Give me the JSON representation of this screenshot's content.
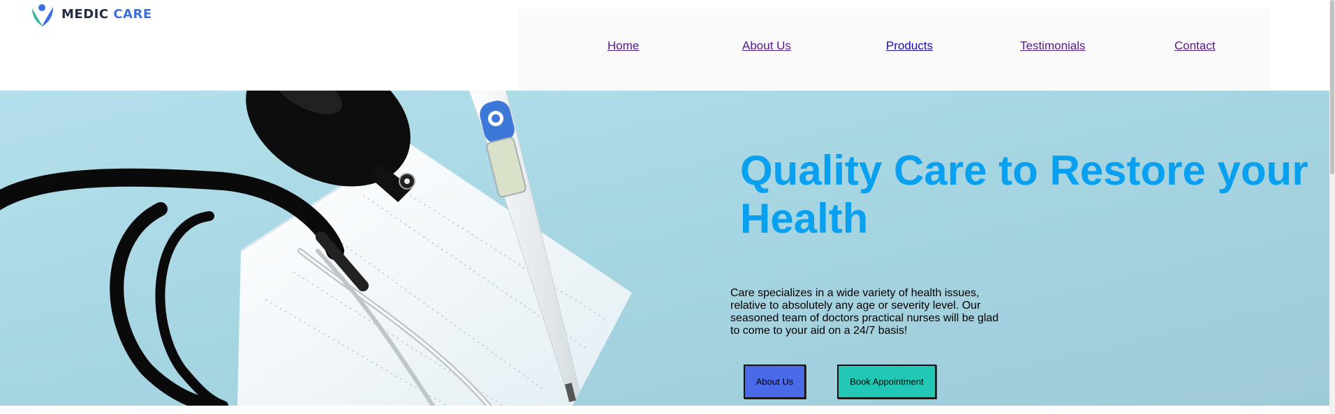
{
  "brand": {
    "name_part1": "MEDIC",
    "name_part2": "CARE"
  },
  "nav": {
    "items": [
      {
        "label": "Home"
      },
      {
        "label": "About Us"
      },
      {
        "label": "Products"
      },
      {
        "label": "Testimonials"
      },
      {
        "label": "Contact"
      }
    ]
  },
  "hero": {
    "title": "Quality Care to Restore your Health",
    "description": "Care specializes in a wide variety of health issues, relative to absolutely any age or severity level. Our seasoned team of doctors practical nurses will be glad to come to your aid on a 24/7 basis!",
    "about_button": "About Us",
    "book_button": "Book Appointment"
  },
  "colors": {
    "hero_title": "#0aa0f0",
    "hero_background": "#a9d6e3",
    "about_button": "#4a6ae8",
    "book_button": "#22c7b5",
    "nav_background": "#fafafa",
    "brand_accent": "#3b6fe0"
  },
  "icons": [
    "logo-mark-icon"
  ],
  "hero_image": "stethoscope-thermometer-mask-photo"
}
